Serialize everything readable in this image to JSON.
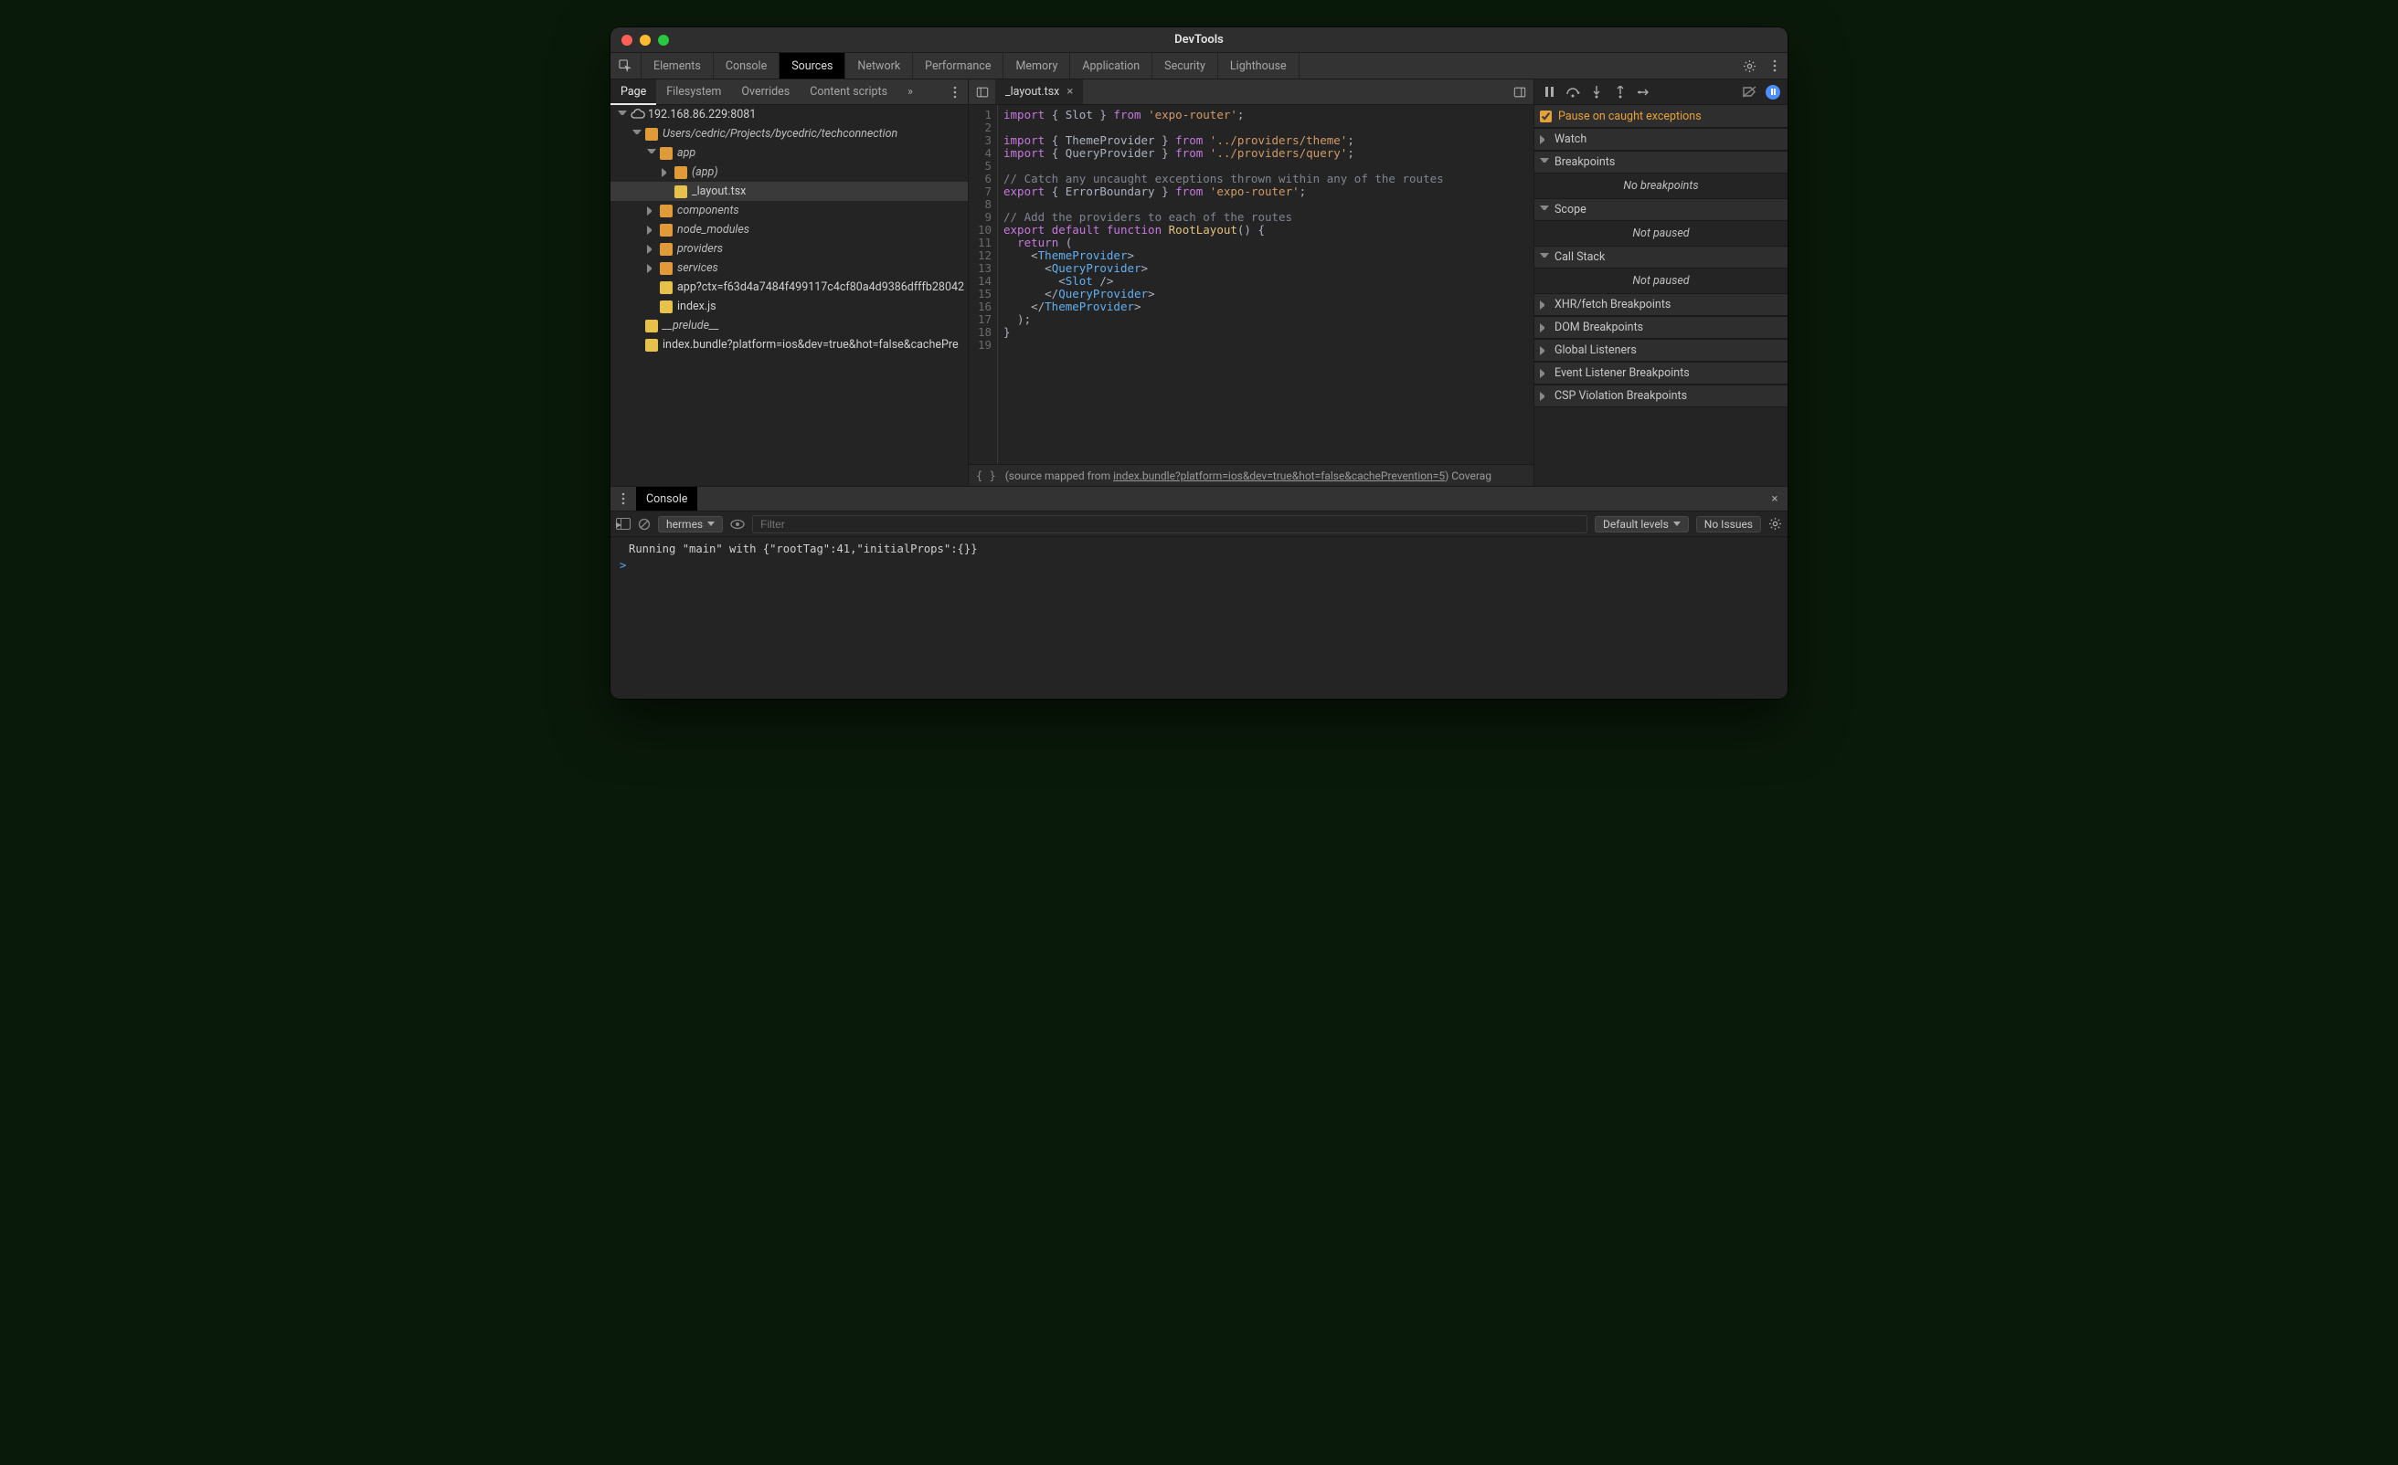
{
  "window": {
    "title": "DevTools"
  },
  "tabs": {
    "items": [
      "Elements",
      "Console",
      "Sources",
      "Network",
      "Performance",
      "Memory",
      "Application",
      "Security",
      "Lighthouse"
    ],
    "active": "Sources"
  },
  "subtabs": {
    "items": [
      "Page",
      "Filesystem",
      "Overrides",
      "Content scripts"
    ],
    "overflow": "»",
    "active": "Page"
  },
  "tree": {
    "origin": "192.168.86.229:8081",
    "rootPath": "Users/cedric/Projects/bycedric/techconnection",
    "nodes": [
      {
        "depth": 0,
        "type": "origin",
        "label": "192.168.86.229:8081",
        "expanded": true,
        "italic": false
      },
      {
        "depth": 1,
        "type": "folder",
        "label": "Users/cedric/Projects/bycedric/techconnection",
        "expanded": true,
        "italic": true
      },
      {
        "depth": 2,
        "type": "folder",
        "label": "app",
        "expanded": true,
        "italic": true
      },
      {
        "depth": 3,
        "type": "folder",
        "label": "(app)",
        "expanded": false,
        "italic": true
      },
      {
        "depth": 3,
        "type": "file",
        "label": "_layout.tsx",
        "expanded": null,
        "italic": false,
        "selected": true
      },
      {
        "depth": 2,
        "type": "folder",
        "label": "components",
        "expanded": false,
        "italic": true
      },
      {
        "depth": 2,
        "type": "folder",
        "label": "node_modules",
        "expanded": false,
        "italic": true
      },
      {
        "depth": 2,
        "type": "folder",
        "label": "providers",
        "expanded": false,
        "italic": true
      },
      {
        "depth": 2,
        "type": "folder",
        "label": "services",
        "expanded": false,
        "italic": true
      },
      {
        "depth": 2,
        "type": "file",
        "label": "app?ctx=f63d4a7484f499117c4cf80a4d9386dfffb28042",
        "expanded": null,
        "italic": false
      },
      {
        "depth": 2,
        "type": "file",
        "label": "index.js",
        "expanded": null,
        "italic": false
      },
      {
        "depth": 1,
        "type": "file",
        "label": "__prelude__",
        "expanded": null,
        "italic": true
      },
      {
        "depth": 1,
        "type": "file",
        "label": "index.bundle?platform=ios&dev=true&hot=false&cachePre",
        "expanded": null,
        "italic": false
      }
    ]
  },
  "editor": {
    "tabName": "_layout.tsx",
    "lineCount": 19,
    "lines": [
      [
        {
          "t": "import ",
          "c": "kw"
        },
        {
          "t": "{ Slot } ",
          "c": "punc"
        },
        {
          "t": "from ",
          "c": "kw"
        },
        {
          "t": "'expo-router'",
          "c": "str"
        },
        {
          "t": ";",
          "c": "punc"
        }
      ],
      [],
      [
        {
          "t": "import ",
          "c": "kw"
        },
        {
          "t": "{ ThemeProvider } ",
          "c": "punc"
        },
        {
          "t": "from ",
          "c": "kw"
        },
        {
          "t": "'../providers/theme'",
          "c": "str"
        },
        {
          "t": ";",
          "c": "punc"
        }
      ],
      [
        {
          "t": "import ",
          "c": "kw"
        },
        {
          "t": "{ QueryProvider } ",
          "c": "punc"
        },
        {
          "t": "from ",
          "c": "kw"
        },
        {
          "t": "'../providers/query'",
          "c": "str"
        },
        {
          "t": ";",
          "c": "punc"
        }
      ],
      [],
      [
        {
          "t": "// Catch any uncaught exceptions thrown within any of the routes",
          "c": "cmt"
        }
      ],
      [
        {
          "t": "export ",
          "c": "kw"
        },
        {
          "t": "{ ErrorBoundary } ",
          "c": "punc"
        },
        {
          "t": "from ",
          "c": "kw"
        },
        {
          "t": "'expo-router'",
          "c": "str"
        },
        {
          "t": ";",
          "c": "punc"
        }
      ],
      [],
      [
        {
          "t": "// Add the providers to each of the routes",
          "c": "cmt"
        }
      ],
      [
        {
          "t": "export ",
          "c": "kw"
        },
        {
          "t": "default ",
          "c": "kw"
        },
        {
          "t": "function ",
          "c": "kw"
        },
        {
          "t": "RootLayout",
          "c": "fn"
        },
        {
          "t": "() {",
          "c": "punc"
        }
      ],
      [
        {
          "t": "  ",
          "c": "punc"
        },
        {
          "t": "return ",
          "c": "kw"
        },
        {
          "t": "(",
          "c": "punc"
        }
      ],
      [
        {
          "t": "    <",
          "c": "punc"
        },
        {
          "t": "ThemeProvider",
          "c": "tag"
        },
        {
          "t": ">",
          "c": "punc"
        }
      ],
      [
        {
          "t": "      <",
          "c": "punc"
        },
        {
          "t": "QueryProvider",
          "c": "tag"
        },
        {
          "t": ">",
          "c": "punc"
        }
      ],
      [
        {
          "t": "        <",
          "c": "punc"
        },
        {
          "t": "Slot",
          "c": "tag"
        },
        {
          "t": " />",
          "c": "punc"
        }
      ],
      [
        {
          "t": "      </",
          "c": "punc"
        },
        {
          "t": "QueryProvider",
          "c": "tag"
        },
        {
          "t": ">",
          "c": "punc"
        }
      ],
      [
        {
          "t": "    </",
          "c": "punc"
        },
        {
          "t": "ThemeProvider",
          "c": "tag"
        },
        {
          "t": ">",
          "c": "punc"
        }
      ],
      [
        {
          "t": "  );",
          "c": "punc"
        }
      ],
      [
        {
          "t": "}",
          "c": "punc"
        }
      ],
      []
    ],
    "status": {
      "prefix": "(source mapped from ",
      "link": "index.bundle?platform=ios&dev=true&hot=false&cachePrevention=5",
      "suffix": ")  Coverag"
    }
  },
  "debugger": {
    "pauseOnCaught": "Pause on caught exceptions",
    "sections": {
      "watch": "Watch",
      "breakpoints": "Breakpoints",
      "breakpointsBody": "No breakpoints",
      "scope": "Scope",
      "scopeBody": "Not paused",
      "callstack": "Call Stack",
      "callstackBody": "Not paused",
      "xhr": "XHR/fetch Breakpoints",
      "dom": "DOM Breakpoints",
      "global": "Global Listeners",
      "event": "Event Listener Breakpoints",
      "csp": "CSP Violation Breakpoints"
    }
  },
  "console": {
    "tab": "Console",
    "context": "hermes",
    "filterPlaceholder": "Filter",
    "levels": "Default levels",
    "issues": "No Issues",
    "log": "Running \"main\" with {\"rootTag\":41,\"initialProps\":{}}",
    "prompt": ">"
  }
}
